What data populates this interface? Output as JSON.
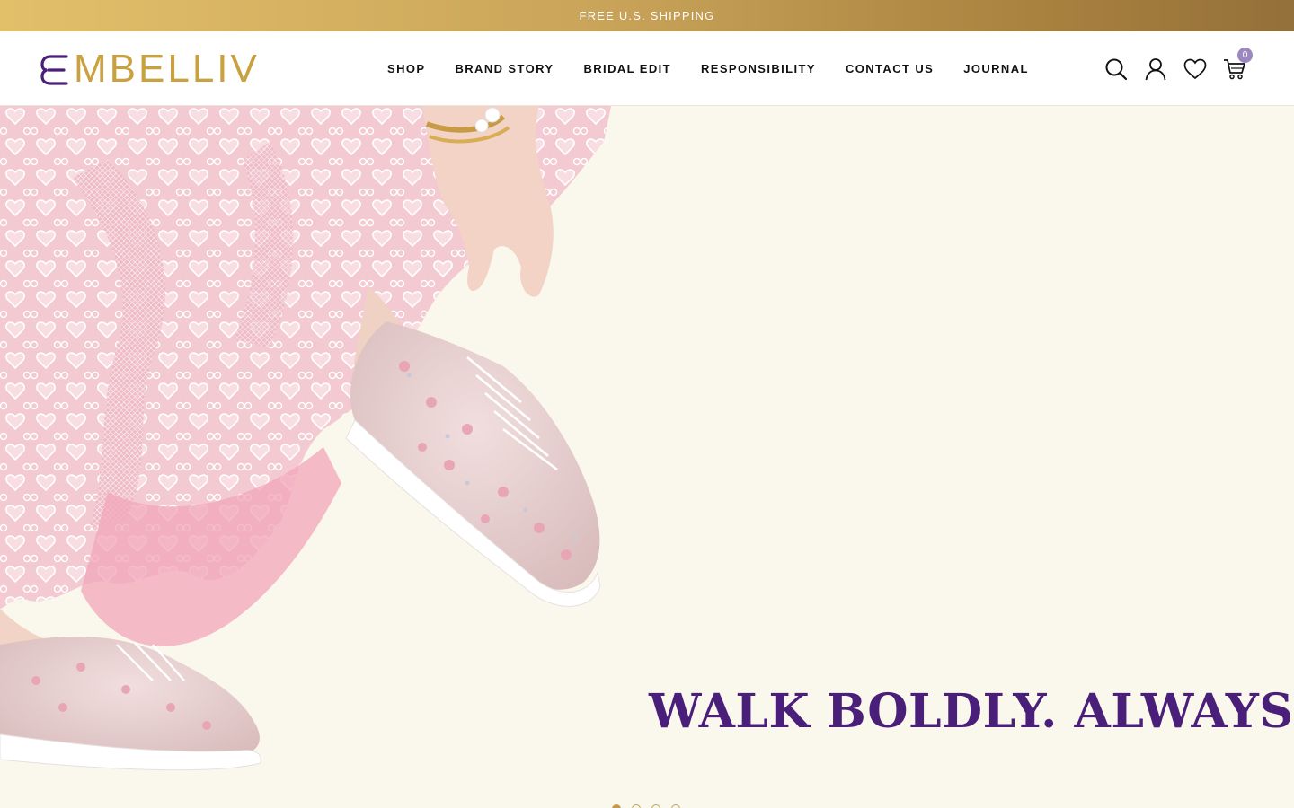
{
  "announcement": {
    "text": "FREE U.S. SHIPPING"
  },
  "brand": {
    "name": "MBELLIV",
    "logo_mark": "E-monogram-logo",
    "primary_color": "#4a1f7a",
    "gold_color": "#c9a13e"
  },
  "nav": {
    "items": [
      {
        "label": "SHOP"
      },
      {
        "label": "BRAND STORY"
      },
      {
        "label": "BRIDAL EDIT"
      },
      {
        "label": "RESPONSIBILITY"
      },
      {
        "label": "CONTACT US"
      },
      {
        "label": "JOURNAL"
      }
    ]
  },
  "header_icons": {
    "search": "search-icon",
    "account": "user-icon",
    "wishlist": "heart-icon",
    "cart": "cart-icon",
    "cart_count": "0"
  },
  "hero": {
    "headline": "WALK BOLDLY. ALWAYS.",
    "image": "embellished-pink-sneakers-lace-dress",
    "slides": 4,
    "active_slide": 1
  }
}
